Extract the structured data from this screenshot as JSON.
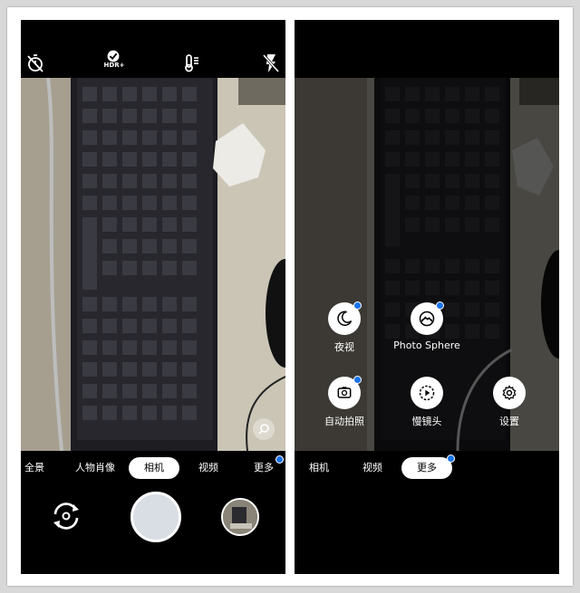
{
  "left_screen": {
    "top_icons": [
      "timer-off-icon",
      "hdr-plus-icon",
      "white-balance-icon",
      "flash-off-icon"
    ],
    "hdr_label": "HDR+",
    "modes": [
      "全景",
      "人物肖像",
      "相机",
      "视频",
      "更多"
    ],
    "selected_mode": "相机",
    "more_badge_color": "#1a73e8"
  },
  "right_screen": {
    "modes": [
      "相机",
      "视频",
      "更多"
    ],
    "selected_mode": "更多",
    "menu_items": [
      {
        "label": "夜视",
        "icon": "moon-icon",
        "badge": true
      },
      {
        "label": "Photo Sphere",
        "icon": "photo-sphere-icon",
        "badge": true
      },
      {
        "label": "自动拍照",
        "icon": "auto-capture-icon",
        "badge": true
      },
      {
        "label": "慢镜头",
        "icon": "slow-motion-icon",
        "badge": false
      },
      {
        "label": "设置",
        "icon": "gear-icon",
        "badge": false
      }
    ]
  },
  "colors": {
    "accent": "#1a73e8",
    "shutter": "#d9dde4"
  }
}
